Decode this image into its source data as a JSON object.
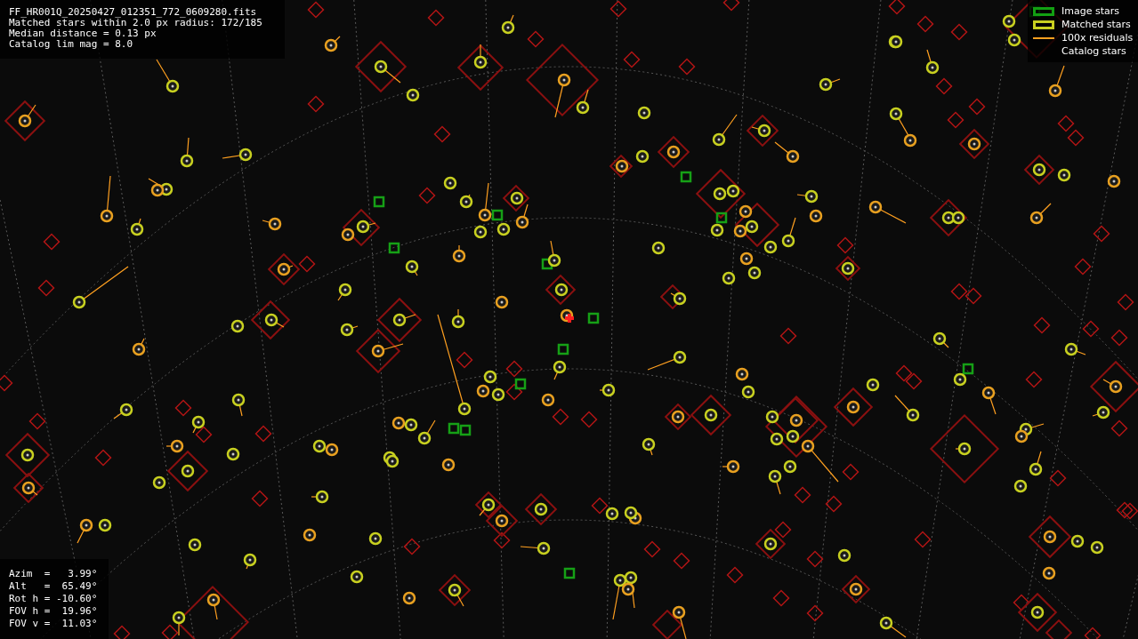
{
  "header": {
    "lines": [
      "FF_HR001Q_20250427_012351_772_0609280.fits",
      "Matched stars within 2.0 px radius: 172/185",
      "Median distance = 0.13 px",
      "Catalog lim mag = 8.0"
    ]
  },
  "legend": {
    "items": [
      {
        "kind": "image",
        "label": "Image stars"
      },
      {
        "kind": "matched",
        "label": "Matched stars"
      },
      {
        "kind": "residual",
        "label": "100x residuals"
      },
      {
        "kind": "catalog",
        "label": "Catalog stars"
      }
    ]
  },
  "pointing": {
    "lines": [
      "Azim  =   3.99°",
      "Alt   =  65.49°",
      "Rot h = -10.60°",
      "FOV h =  19.96°",
      "FOV v =  11.03°"
    ]
  }
}
